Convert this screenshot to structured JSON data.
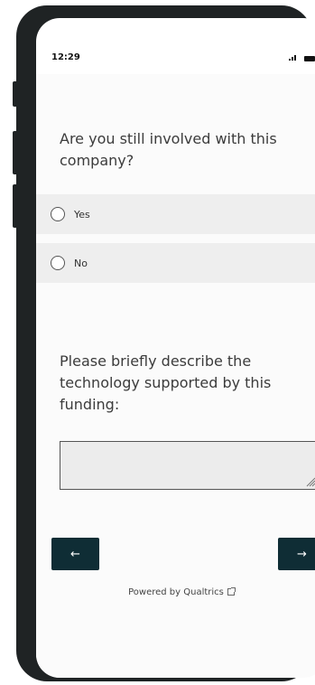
{
  "status_bar": {
    "time": "12:29"
  },
  "survey": {
    "q1": {
      "text": "Are you still involved with this company?",
      "options": [
        "Yes",
        "No"
      ]
    },
    "q2": {
      "text": "Please briefly describe the technology supported by this funding:",
      "answer": ""
    }
  },
  "nav": {
    "back_label": "←",
    "next_label": "→"
  },
  "footer": {
    "powered_by": "Powered by Qualtrics"
  },
  "colors": {
    "button": "#0f2d35",
    "option_bg": "#eeeeee",
    "frame": "#1f2324"
  },
  "icons": [
    "signal-icon",
    "battery-icon",
    "external-link-icon",
    "resize-grip-icon"
  ]
}
